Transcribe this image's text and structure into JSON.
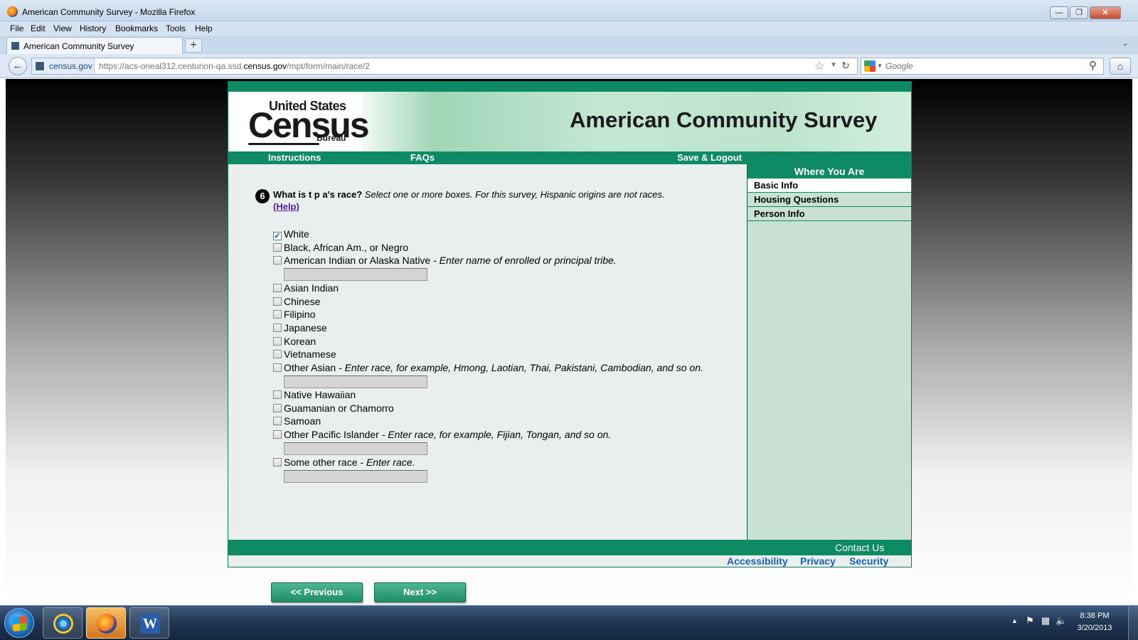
{
  "window": {
    "title": "American Community Survey - Mozilla Firefox",
    "minimize": "—",
    "restore": "❐",
    "close": "✕"
  },
  "menu": [
    "File",
    "Edit",
    "View",
    "History",
    "Bookmarks",
    "Tools",
    "Help"
  ],
  "tab": {
    "label": "American Community Survey",
    "new_tab": "+",
    "list_all": "⌄"
  },
  "urlbar": {
    "identity": "census.gov",
    "url_prefix": "https://acs-oneal312.centurion-qa.ssd.",
    "url_domain": "census.gov",
    "url_path": "/mpt/form/main/race/2",
    "star": "☆",
    "drop": "▼",
    "reload": "↻"
  },
  "search": {
    "placeholder": "Google",
    "go": "⚲"
  },
  "nav": {
    "back": "←",
    "home": "⌂"
  },
  "census_logo": {
    "line1": "United States",
    "tm": "™",
    "line2": "Census",
    "line3": "Bureau"
  },
  "header_title": "American Community Survey",
  "topnav": {
    "instructions": "Instructions",
    "faqs": "FAQs",
    "save_logout": "Save & Logout"
  },
  "sidebar": {
    "title": "Where You Are",
    "items": [
      {
        "label": "Basic Info",
        "active": true
      },
      {
        "label": "Housing Questions",
        "active": false
      },
      {
        "label": "Person Info",
        "active": false
      }
    ]
  },
  "question": {
    "number": "6",
    "prompt": "What is t p a's race?",
    "instruction": " Select one or more boxes. For this survey, Hispanic origins are not races.",
    "help": "(Help)"
  },
  "options": [
    {
      "label": "White",
      "checked": true,
      "desc": ""
    },
    {
      "label": "Black, African Am., or Negro",
      "checked": false,
      "desc": ""
    },
    {
      "label": "American Indian or Alaska Native",
      "checked": false,
      "desc": " - Enter name of enrolled or principal tribe."
    },
    {
      "label": "Asian Indian",
      "checked": false,
      "desc": ""
    },
    {
      "label": "Chinese",
      "checked": false,
      "desc": ""
    },
    {
      "label": "Filipino",
      "checked": false,
      "desc": ""
    },
    {
      "label": "Japanese",
      "checked": false,
      "desc": ""
    },
    {
      "label": "Korean",
      "checked": false,
      "desc": ""
    },
    {
      "label": "Vietnamese",
      "checked": false,
      "desc": ""
    },
    {
      "label": "Other Asian",
      "checked": false,
      "desc": " - Enter race, for example, Hmong, Laotian, Thai, Pakistani, Cambodian, and so on."
    },
    {
      "label": "Native Hawaiian",
      "checked": false,
      "desc": ""
    },
    {
      "label": "Guamanian or Chamorro",
      "checked": false,
      "desc": ""
    },
    {
      "label": "Samoan",
      "checked": false,
      "desc": ""
    },
    {
      "label": "Other Pacific Islander",
      "checked": false,
      "desc": " - Enter race, for example, Fijian, Tongan, and so on."
    },
    {
      "label": "Some other race",
      "checked": false,
      "desc": " - Enter race."
    }
  ],
  "buttons": {
    "previous": "<<   Previous",
    "next": "Next   >>"
  },
  "footer": {
    "contact": "Contact Us",
    "links": [
      "Accessibility",
      "Privacy",
      "Security"
    ]
  },
  "taskbar": {
    "time": "8:38 PM",
    "date": "3/20/2013",
    "word_icon": "W"
  }
}
